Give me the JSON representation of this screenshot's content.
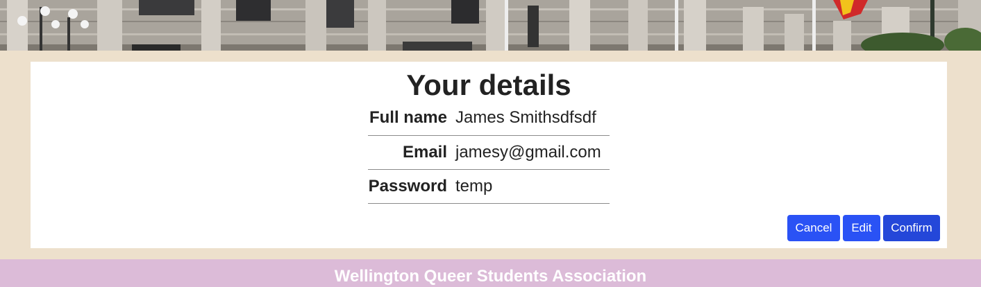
{
  "hero": {
    "icon": "parliament-building-photo"
  },
  "details": {
    "title": "Your details",
    "rows": [
      {
        "label": "Full name",
        "value": "James Smithsdfsdf"
      },
      {
        "label": "Email",
        "value": "jamesy@gmail.com"
      },
      {
        "label": "Password",
        "value": "temp"
      }
    ]
  },
  "actions": {
    "cancel_label": "Cancel",
    "edit_label": "Edit",
    "confirm_label": "Confirm"
  },
  "footer": {
    "org_name": "Wellington Queer Students Association"
  },
  "colors": {
    "page_background": "#ede0cc",
    "button": "#2a52f5",
    "button_focused": "#2447d9",
    "footer": "#dcbbd8"
  }
}
